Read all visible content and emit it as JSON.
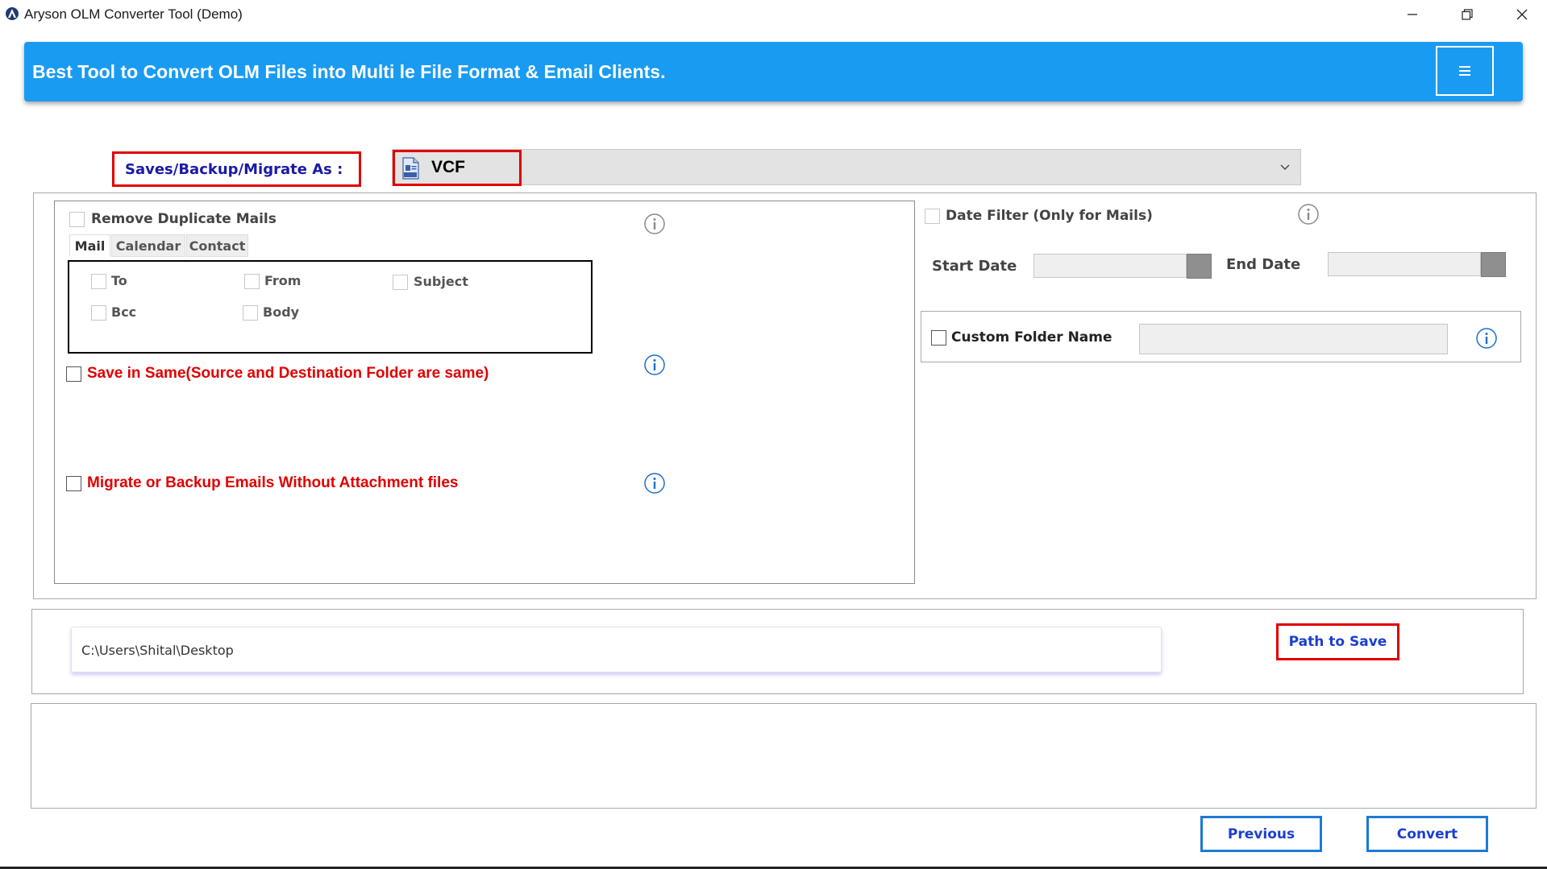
{
  "window": {
    "title": "Aryson OLM Converter Tool (Demo)",
    "controls": {
      "minimize": "minimize-icon",
      "restore": "restore-icon",
      "close": "close-icon"
    }
  },
  "banner": {
    "text": "Best Tool to Convert OLM Files into Multi le File Format & Email Clients.",
    "menu_icon": "≡"
  },
  "format": {
    "label": "Saves/Backup/Migrate As :",
    "selected": "VCF",
    "selected_icon": "vcf-file-icon"
  },
  "left_panel": {
    "remove_duplicates": {
      "label": "Remove Duplicate Mails",
      "checked": false,
      "enabled": false
    },
    "tabs": [
      {
        "label": "Mail",
        "active": true
      },
      {
        "label": "Calendar",
        "active": false
      },
      {
        "label": "Contact",
        "active": false
      }
    ],
    "fields": [
      "To",
      "From",
      "Subject",
      "Bcc",
      "Body"
    ],
    "save_same": {
      "label": "Save in Same(Source and Destination Folder are same)",
      "checked": false
    },
    "without_attachments": {
      "label": "Migrate or Backup Emails Without Attachment files",
      "checked": false
    }
  },
  "right_panel": {
    "date_filter": {
      "label": "Date Filter  (Only for Mails)",
      "checked": false,
      "enabled": false
    },
    "start_date_label": "Start Date",
    "end_date_label": "End Date",
    "custom_folder": {
      "label": "Custom Folder Name",
      "checked": false
    }
  },
  "path": {
    "value": "C:\\Users\\Shital\\Desktop",
    "button": "Path to Save"
  },
  "buttons": {
    "previous": "Previous",
    "convert": "Convert"
  },
  "colors": {
    "banner": "#1a9bf2",
    "highlight": "#e00000",
    "label_blue": "#1a1aa6",
    "button_text": "#1a3fd0",
    "button_border": "#1c7ad6",
    "warning_red": "#e00000"
  }
}
